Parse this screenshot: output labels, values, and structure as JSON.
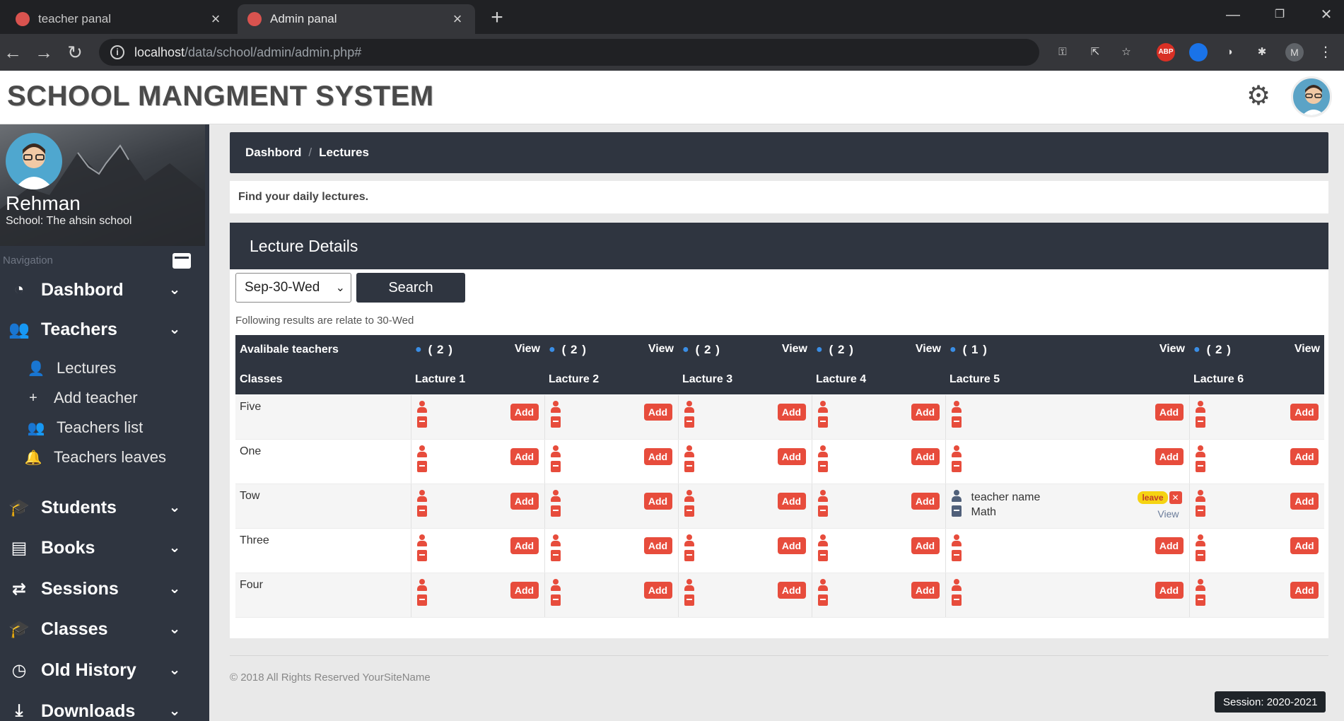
{
  "browser": {
    "tabs": [
      {
        "title": "teacher panal",
        "active": false
      },
      {
        "title": "Admin panal",
        "active": true
      }
    ],
    "url_host": "localhost",
    "url_path": "/data/school/admin/admin.php#",
    "profile_letter": "M"
  },
  "header": {
    "title": "SCHOOL MANGMENT SYSTEM"
  },
  "sidebar": {
    "name": "Rehman",
    "school": "School: The ahsin school",
    "nav_label": "Navigation",
    "menu": [
      {
        "label": "Dashbord",
        "icon": "dashboard-icon"
      },
      {
        "label": "Teachers",
        "icon": "users-icon"
      },
      {
        "label": "Students",
        "icon": "student-icon"
      },
      {
        "label": "Books",
        "icon": "book-icon"
      },
      {
        "label": "Sessions",
        "icon": "retweet-icon"
      },
      {
        "label": "Classes",
        "icon": "graduation-cap-icon"
      },
      {
        "label": "Old History",
        "icon": "clock-icon"
      },
      {
        "label": "Downloads",
        "icon": "download-icon"
      }
    ],
    "teachers_sub": [
      {
        "label": "Lectures",
        "icon": "user-edit-icon"
      },
      {
        "label": "Add teacher",
        "icon": "plus-icon"
      },
      {
        "label": "Teachers list",
        "icon": "users-icon"
      },
      {
        "label": "Teachers leaves",
        "icon": "bell-icon"
      }
    ]
  },
  "breadcrumb": {
    "items": [
      "Dashbord",
      "Lectures"
    ],
    "separator": "/"
  },
  "subtitle": "Find your daily lectures.",
  "panel": {
    "title": "Lecture Details",
    "date_value": "Sep-30-Wed",
    "search_label": "Search",
    "result_note": "Following results are relate to 30-Wed",
    "available_label": "Avalibale teachers",
    "classes_label": "Classes",
    "view_label": "View",
    "add_label": "Add",
    "lectures": [
      {
        "name": "Lacture 1",
        "count": "( 2 )"
      },
      {
        "name": "Lacture 2",
        "count": "( 2 )"
      },
      {
        "name": "Lacture 3",
        "count": "( 2 )"
      },
      {
        "name": "Lacture 4",
        "count": "( 2 )"
      },
      {
        "name": "Lacture 5",
        "count": "( 1 )"
      },
      {
        "name": "Lacture 6",
        "count": "( 2 )"
      }
    ],
    "classes": [
      "Five",
      "One",
      "Tow",
      "Three",
      "Four"
    ],
    "assigned": {
      "teacher_name": "teacher name",
      "subject": "Math",
      "leave_label": "leave",
      "view_label": "View"
    }
  },
  "footer": {
    "copyright": "© 2018 All Rights Reserved YourSiteName",
    "session": "Session: 2020-2021"
  },
  "colors": {
    "dark": "#2f3540",
    "accent_red": "#e74c3c",
    "accent_blue": "#3a8ee6",
    "leave_yellow": "#f5d312"
  }
}
